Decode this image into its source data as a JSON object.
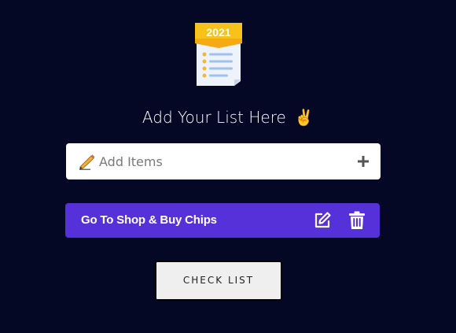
{
  "logo": {
    "year": "2021",
    "icon": "checklist-document-icon"
  },
  "heading": {
    "text": "Add Your List Here",
    "emoji": "✌️"
  },
  "add_item": {
    "placeholder": "Add Items",
    "value": "",
    "leading_icon": "writing-hand-icon",
    "add_icon": "plus-icon"
  },
  "items": [
    {
      "label": "Go To Shop & Buy Chips",
      "edit_icon": "edit-icon",
      "delete_icon": "trash-icon"
    }
  ],
  "check_button": {
    "label": "CHECK LIST"
  },
  "colors": {
    "background": "#050824",
    "item_bar": "#5630d8",
    "input_bg": "#ffffff",
    "button_bg": "#efefef",
    "logo_banner": "#f9c21b"
  }
}
